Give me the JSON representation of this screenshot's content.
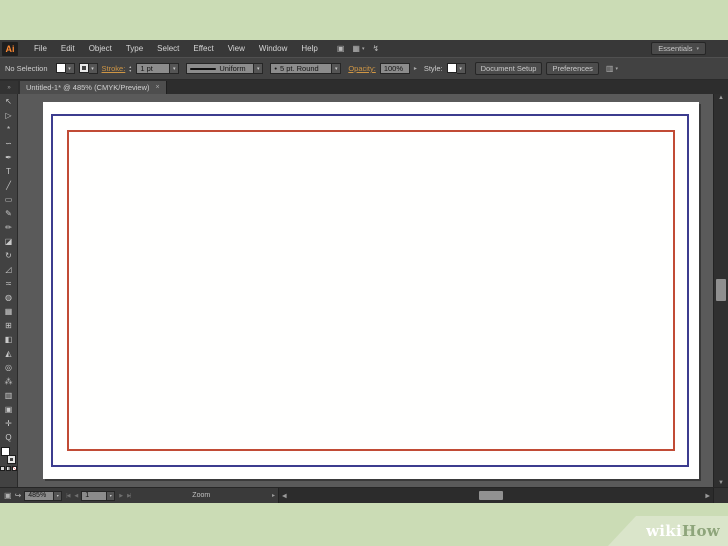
{
  "colors": {
    "background_green": "#cbdcb5",
    "wedge_green": "#dae5ca",
    "how_green": "#8ea57b",
    "panel_mid": "#424242",
    "pasteboard": "#5a5a5a",
    "accent_label_orange": "#cf9645",
    "logo_orange": "#ff8a33",
    "rect_blue": "#3c3c8e",
    "rect_red": "#c14b35"
  },
  "menu_bar": {
    "logo": "Ai",
    "items": [
      "File",
      "Edit",
      "Object",
      "Type",
      "Select",
      "Effect",
      "View",
      "Window",
      "Help"
    ],
    "workspace_label": "Essentials",
    "bridge_icon_glyph": "▣",
    "arrange_documents_glyph": "▦",
    "view_options_glyph": "↯"
  },
  "control_bar": {
    "selection_status": "No Selection",
    "stroke_label": "Stroke:",
    "stroke_weight": "1 pt",
    "variable_width_profile": "Uniform",
    "brush_bullet": "•",
    "brush_definition": "5 pt. Round",
    "opacity_label": "Opacity:",
    "opacity_value": "100%",
    "style_label": "Style:",
    "document_setup_label": "Document Setup",
    "preferences_label": "Preferences"
  },
  "document_tab": {
    "title": "Untitled-1* @ 485% (CMYK/Preview)",
    "close_glyph": "×"
  },
  "toolbar": {
    "collapse_glyph": "»",
    "tools": [
      {
        "name": "tool-selection",
        "glyph": "↖"
      },
      {
        "name": "tool-direct-selection",
        "glyph": "▷"
      },
      {
        "name": "tool-magic-wand",
        "glyph": "*"
      },
      {
        "name": "tool-lasso",
        "glyph": "∽"
      },
      {
        "name": "tool-pen",
        "glyph": "✒"
      },
      {
        "name": "tool-type",
        "glyph": "T"
      },
      {
        "name": "tool-line-segment",
        "glyph": "╱"
      },
      {
        "name": "tool-rectangle",
        "glyph": "▭"
      },
      {
        "name": "tool-paintbrush",
        "glyph": "✎"
      },
      {
        "name": "tool-pencil",
        "glyph": "✏"
      },
      {
        "name": "tool-eraser",
        "glyph": "◪"
      },
      {
        "name": "tool-rotate",
        "glyph": "↻"
      },
      {
        "name": "tool-scale",
        "glyph": "◿"
      },
      {
        "name": "tool-width",
        "glyph": "≍"
      },
      {
        "name": "tool-shape-builder",
        "glyph": "◍"
      },
      {
        "name": "tool-perspective-grid",
        "glyph": "▦"
      },
      {
        "name": "tool-mesh",
        "glyph": "⊞"
      },
      {
        "name": "tool-gradient",
        "glyph": "◧"
      },
      {
        "name": "tool-eyedropper",
        "glyph": "◭"
      },
      {
        "name": "tool-blend",
        "glyph": "◎"
      },
      {
        "name": "tool-symbol-sprayer",
        "glyph": "⁂"
      },
      {
        "name": "tool-column-graph",
        "glyph": "▥"
      },
      {
        "name": "tool-artboard",
        "glyph": "▣"
      },
      {
        "name": "tool-hand",
        "glyph": "✛"
      },
      {
        "name": "tool-zoom",
        "glyph": "Q"
      }
    ]
  },
  "status_bar": {
    "zoom_value": "485%",
    "artboard_number": "1",
    "tool_hint": "Zoom",
    "nav_first": "|◀",
    "nav_prev": "◀",
    "nav_next": "▶",
    "nav_last": "▶|",
    "doc_icon_glyph": "▣",
    "share_icon_glyph": "↪"
  },
  "icons": {
    "dropdown": "▾",
    "stepper_up": "▴",
    "stepper_down": "▾",
    "panel_arrow": "▸",
    "scroll_up": "▲",
    "scroll_down": "▼",
    "scroll_left": "◀",
    "scroll_right": "▶"
  },
  "watermark": {
    "wiki": "wiki",
    "how": "How"
  }
}
